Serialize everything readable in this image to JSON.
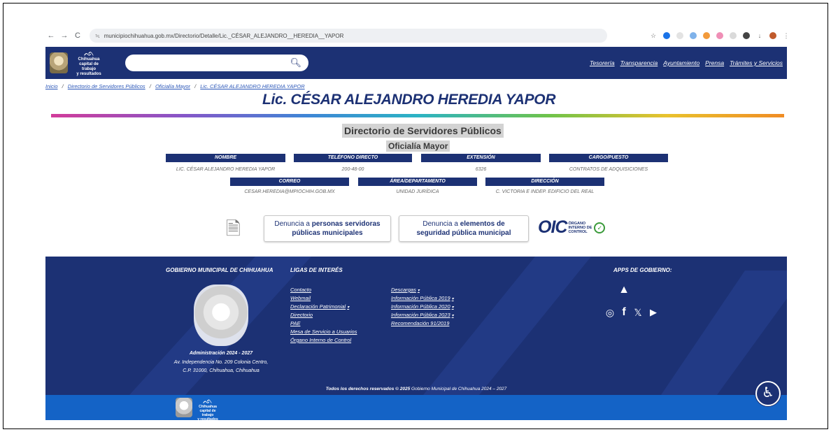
{
  "browser": {
    "url": "municipiochihuahua.gob.mx/Directorio/Detalle/Lic._CÉSAR_ALEJANDRO__HEREDIA__YAPOR",
    "back": "←",
    "forward": "→",
    "reload": "C",
    "site_info": "≒"
  },
  "header": {
    "logo_mark": "ᨒ",
    "logo_line1": "Chihuahua",
    "logo_line2": "capital de trabajo",
    "logo_line3": "y resultados",
    "search_placeholder": "",
    "nav": [
      "Tesorería",
      "Transparencia",
      "Ayuntamiento",
      "Prensa",
      "Trámites y Servicios"
    ]
  },
  "breadcrumb": {
    "items": [
      "Inicio",
      "Directorio de Servidores Públicos",
      "Oficialía Mayor",
      "Lic. CÉSAR ALEJANDRO HEREDIA YAPOR"
    ],
    "separator": "/"
  },
  "page_title": "Lic. CÉSAR ALEJANDRO HEREDIA YAPOR",
  "directory": {
    "title": "Directorio de Servidores Públicos",
    "department": "Oficialía Mayor",
    "headers_row1": [
      "NOMBRE",
      "TELÉFONO DIRECTO",
      "EXTENSIÓN",
      "CARGO/PUESTO"
    ],
    "values_row1": [
      "LIC. CÉSAR ALEJANDRO HEREDIA YAPOR",
      "200-48-00",
      "6326",
      "CONTRATOS DE ADQUISICIONES"
    ],
    "headers_row2": [
      "CORREO",
      "ÁREA/DEPARTAMENTO",
      "DIRECCIÓN"
    ],
    "values_row2": [
      "CESAR.HEREDIA@MPIOCHIH.GOB.MX",
      "UNIDAD JURÍDICA",
      "C. VICTORIA E INDEP. EDIFICIO DEL REAL"
    ]
  },
  "denuncia": {
    "box1_pre": "Denuncia a",
    "box1_bold1": "personas servidoras",
    "box1_bold2": "públicas municipales",
    "box2_pre": "Denuncia a",
    "box2_bold1": "elementos de",
    "box2_bold2": "seguridad pública municipal",
    "oic": "OIC",
    "oic_line1": "ÓRGANO",
    "oic_line2": "INTERNO DE",
    "oic_line3": "CONTROL"
  },
  "footer": {
    "gov_title": "GOBIERNO MUNICIPAL DE CHIHUAHUA",
    "links_title": "LIGAS DE INTERÉS",
    "apps_title": "APPS DE GOBIERNO:",
    "admin": "Administración 2024 - 2027",
    "address1": "Av. Independencia No. 209 Colonia Centro,",
    "address2": "C.P. 31000, Chihuahua, Chihuahua",
    "links_col1": [
      "Contacto",
      "Webmail",
      "Declaración Patrimonial",
      "Directorio",
      "PAE",
      "Mesa de Servicio a Usuarios",
      "Órgano Interno de Control"
    ],
    "links_col2": [
      "Descargas",
      "Información Pública 2019",
      "Información Pública 2020",
      "Información Pública 2023",
      "Recomendación 91/2019"
    ],
    "copyright_bold": "Todos los derechos reservados © 2025",
    "copyright_rest": "Gobierno Municipal de Chihuahua 2024 – 2027",
    "icons": {
      "android": "android-icon",
      "apple": "apple-icon",
      "instagram": "instagram-icon",
      "facebook": "facebook-icon",
      "x": "x-icon",
      "youtube": "youtube-icon"
    }
  },
  "colors": {
    "navy": "#1c3174",
    "footer_bottom": "#1463c6",
    "link": "#2b57b8"
  }
}
